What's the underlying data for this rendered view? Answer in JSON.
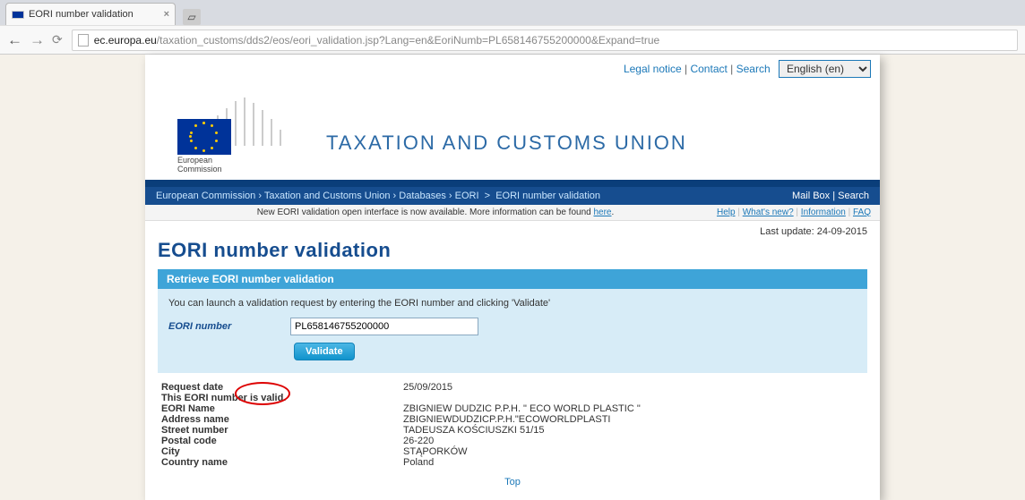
{
  "browser": {
    "tab_title": "EORI number validation",
    "url_host": "ec.europa.eu",
    "url_path": "/taxation_customs/dds2/eos/eori_validation.jsp?Lang=en&EoriNumb=PL658146755200000&Expand=true"
  },
  "toplinks": {
    "legal": "Legal notice",
    "contact": "Contact",
    "search": "Search",
    "language": "English (en)"
  },
  "header": {
    "logo_caption_1": "European",
    "logo_caption_2": "Commission",
    "site_title": "TAXATION AND CUSTOMS UNION"
  },
  "breadcrumbs": {
    "items": [
      "European Commission",
      "Taxation and Customs Union",
      "Databases",
      "EORI",
      "EORI number validation"
    ],
    "mailbox": "Mail Box",
    "search": "Search"
  },
  "notice": {
    "text": "New EORI validation open interface is now available. More information can be found ",
    "link": "here",
    "help": "Help",
    "whatsnew": "What's new?",
    "info": "Information",
    "faq": "FAQ"
  },
  "lastupdate": "Last update: 24-09-2015",
  "page_title": "EORI number validation",
  "retrieve": {
    "head": "Retrieve EORI number validation",
    "intro": "You can launch a validation request by entering the EORI number and clicking 'Validate'",
    "label": "EORI number",
    "value": "PL658146755200000",
    "button": "Validate"
  },
  "results": {
    "request_date_label": "Request date",
    "request_date": "25/09/2015",
    "valid_text": "This EORI number is valid.",
    "rows": [
      {
        "label": "EORI Name",
        "value": "ZBIGNIEW DUDZIC P.P.H. \" ECO WORLD PLASTIC \""
      },
      {
        "label": "Address name",
        "value": "ZBIGNIEWDUDZICP.P.H.\"ECOWORLDPLASTI"
      },
      {
        "label": "Street number",
        "value": "TADEUSZA KOŚCIUSZKI 51/15"
      },
      {
        "label": "Postal code",
        "value": "26-220"
      },
      {
        "label": "City",
        "value": "STĄPORKÓW"
      },
      {
        "label": "Country name",
        "value": "Poland"
      }
    ]
  },
  "top_link": "Top"
}
